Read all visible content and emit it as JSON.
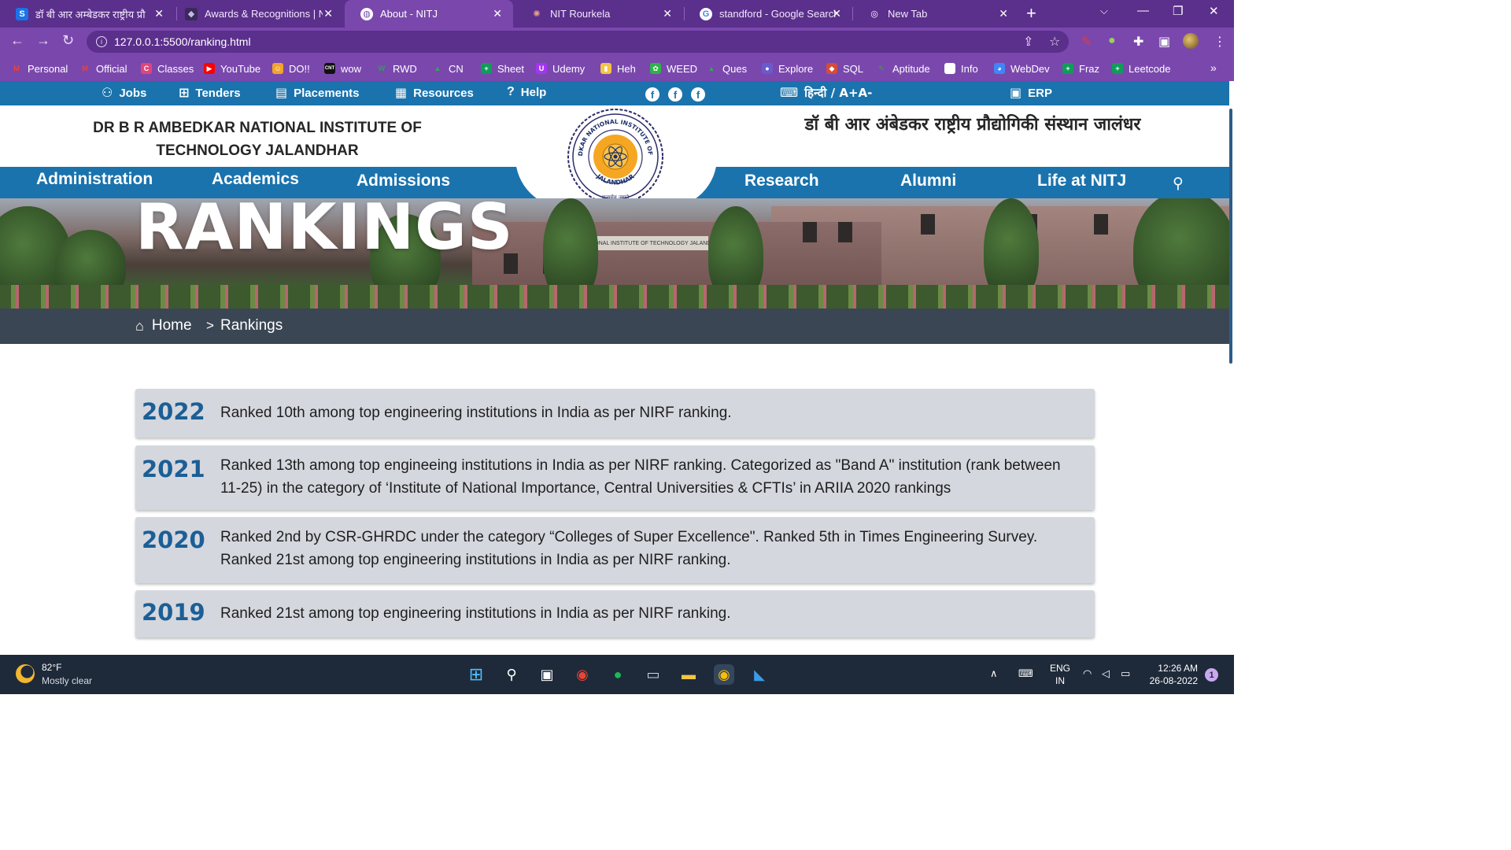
{
  "browser": {
    "tabs": [
      {
        "title": "डॉ बी आर अम्बेडकर राष्ट्रीय प्रौ",
        "favicon": "S",
        "favicon_color": "#1a73e8",
        "active": false
      },
      {
        "title": "Awards & Recognitions | NI",
        "favicon": "◆",
        "favicon_color": "#3a2a5a",
        "active": false
      },
      {
        "title": "About - NITJ",
        "favicon": "◍",
        "favicon_color": "#7a48ad",
        "active": true
      },
      {
        "title": "NIT Rourkela",
        "favicon": "✺",
        "favicon_color": "#8b3a2a",
        "active": false
      },
      {
        "title": "standford - Google Search",
        "favicon": "G",
        "favicon_color": "#ffffff",
        "active": false
      },
      {
        "title": "New Tab",
        "favicon": "◎",
        "favicon_color": "#ffffff",
        "active": false
      }
    ],
    "url": "127.0.0.1:5500/ranking.html",
    "bookmarks": [
      {
        "label": "Personal",
        "color": "#ea4335",
        "glyph": "M"
      },
      {
        "label": "Official",
        "color": "#ea4335",
        "glyph": "M"
      },
      {
        "label": "Classes",
        "color": "#e0457b",
        "glyph": "C"
      },
      {
        "label": "YouTube",
        "color": "#ff0000",
        "glyph": "▶"
      },
      {
        "label": "DO!!",
        "color": "#f2a52b",
        "glyph": "☺"
      },
      {
        "label": "wow",
        "color": "#111111",
        "glyph": "CNT"
      },
      {
        "label": "RWD",
        "color": "#2e9e5b",
        "glyph": "W"
      },
      {
        "label": "CN",
        "color": "#34a853",
        "glyph": "▲"
      },
      {
        "label": "Sheet",
        "color": "#0f9d58",
        "glyph": "+"
      },
      {
        "label": "Udemy",
        "color": "#a435f0",
        "glyph": "U"
      },
      {
        "label": "Heh",
        "color": "#f4c542",
        "glyph": "▮"
      },
      {
        "label": "WEED",
        "color": "#2db24a",
        "glyph": "✿"
      },
      {
        "label": "Ques",
        "color": "#34a853",
        "glyph": "▲"
      },
      {
        "label": "Explore",
        "color": "#6a5acd",
        "glyph": "●"
      },
      {
        "label": "SQL",
        "color": "#d24d3a",
        "glyph": "◆"
      },
      {
        "label": "Aptitude",
        "color": "#3aa13a",
        "glyph": "✎"
      },
      {
        "label": "Info",
        "color": "#ffffff",
        "glyph": "◉"
      },
      {
        "label": "WebDev",
        "color": "#4285f4",
        "glyph": "◕"
      },
      {
        "label": "Fraz",
        "color": "#0f9d58",
        "glyph": "+"
      },
      {
        "label": "Leetcode",
        "color": "#0f9d58",
        "glyph": "+"
      }
    ]
  },
  "site": {
    "top_links": [
      {
        "label": "Jobs",
        "icon": "jobs-icon"
      },
      {
        "label": "Tenders",
        "icon": "tenders-icon"
      },
      {
        "label": "Placements",
        "icon": "placements-icon"
      },
      {
        "label": "Resources",
        "icon": "resources-icon"
      },
      {
        "label": "Help",
        "icon": "help-icon"
      }
    ],
    "lang_toggle": "हिन्दी / A+A-",
    "erp_label": "ERP",
    "institute_name_en": "DR B R AMBEDKAR NATIONAL INSTITUTE OF TECHNOLOGY JALANDHAR",
    "institute_name_hi": "डॉ बी आर अंबेडकर राष्ट्रीय प्रौद्योगिकी संस्थान जालंधर",
    "logo_text_top": "DR B.R. AMBEDKAR NATIONAL INSTITUTE OF TECHNOLOGY",
    "logo_text_bottom": "JALANDHAR",
    "logo_motto": "सत्यमेव जयते",
    "nav": {
      "left": [
        "Administration",
        "Academics",
        "Admissions"
      ],
      "right": [
        "Research",
        "Alumni",
        "Life at NITJ"
      ]
    },
    "hero_title": "RANKINGS",
    "hero_signboard": "NATIONAL INSTITUTE OF TECHNOLOGY JALANDHAR",
    "breadcrumb": {
      "home": "Home",
      "separator": ">",
      "current": "Rankings"
    },
    "rankings": [
      {
        "year": "2022",
        "text": "Ranked 10th among top engineering institutions in India as per NIRF ranking."
      },
      {
        "year": "2021",
        "text": "Ranked 13th among top engineeing institutions in India as per NIRF ranking. Categorized as \"Band A\" institution (rank between 11-25) in the category of ‘Institute of National Importance, Central Universities & CFTIs’ in ARIIA 2020 rankings"
      },
      {
        "year": "2020",
        "text": "Ranked 2nd by CSR-GHRDC under the category “Colleges of Super Excellence\". Ranked 5th in Times Engineering Survey. Ranked 21st among top engineering institutions in India as per NIRF ranking."
      },
      {
        "year": "2019",
        "text": "Ranked 21st among top engineering institutions in India as per NIRF ranking."
      }
    ],
    "colors": {
      "primary": "#1a73ad",
      "year": "#1b5f96",
      "card": "#d5d7de",
      "crumbbar": "#3b4654"
    }
  },
  "taskbar": {
    "weather_temp": "82°F",
    "weather_desc": "Mostly clear",
    "lang_line1": "ENG",
    "lang_line2": "IN",
    "time": "12:26 AM",
    "date": "26-08-2022",
    "notifications": "1"
  }
}
